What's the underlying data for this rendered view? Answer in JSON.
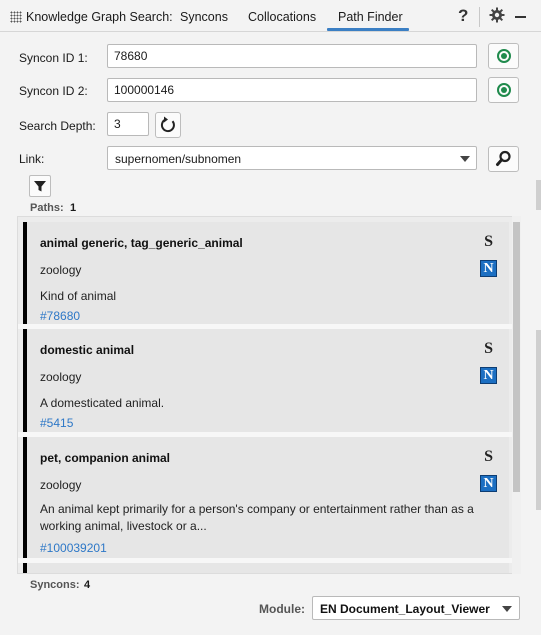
{
  "header": {
    "title": "Knowledge Graph Search:",
    "tabs": [
      {
        "label": "Syncons"
      },
      {
        "label": "Collocations"
      },
      {
        "label": "Path Finder",
        "active": true
      }
    ],
    "help_label": "?"
  },
  "form": {
    "syncon1": {
      "label": "Syncon ID 1:",
      "value": "78680"
    },
    "syncon2": {
      "label": "Syncon ID 2:",
      "value": "100000146"
    },
    "depth": {
      "label": "Search Depth:",
      "value": "3"
    },
    "link": {
      "label": "Link:",
      "value": "supernomen/subnomen"
    }
  },
  "paths": {
    "label": "Paths:",
    "count": "1"
  },
  "results": [
    {
      "title": "animal generic, tag_generic_animal",
      "domain": "zoology",
      "description": "Kind of animal",
      "id": "#78680",
      "s_badge": "S",
      "n_badge": "N"
    },
    {
      "title": "domestic animal",
      "domain": "zoology",
      "description": "A domesticated animal.",
      "id": "#5415",
      "s_badge": "S",
      "n_badge": "N"
    },
    {
      "title": "pet, companion animal",
      "domain": "zoology",
      "description": "An animal kept primarily for a person's company or entertainment rather than as a working animal, livestock or a...",
      "id": "#100039201",
      "s_badge": "S",
      "n_badge": "N"
    }
  ],
  "syncons": {
    "label": "Syncons:",
    "count": "4"
  },
  "module": {
    "label": "Module:",
    "value": "EN  Document_Layout_Viewer"
  },
  "colors": {
    "accent": "#3b7fc4",
    "link": "#2e78c7",
    "status_green": "#1f8a4c",
    "n_badge": "#1c6fc2"
  }
}
